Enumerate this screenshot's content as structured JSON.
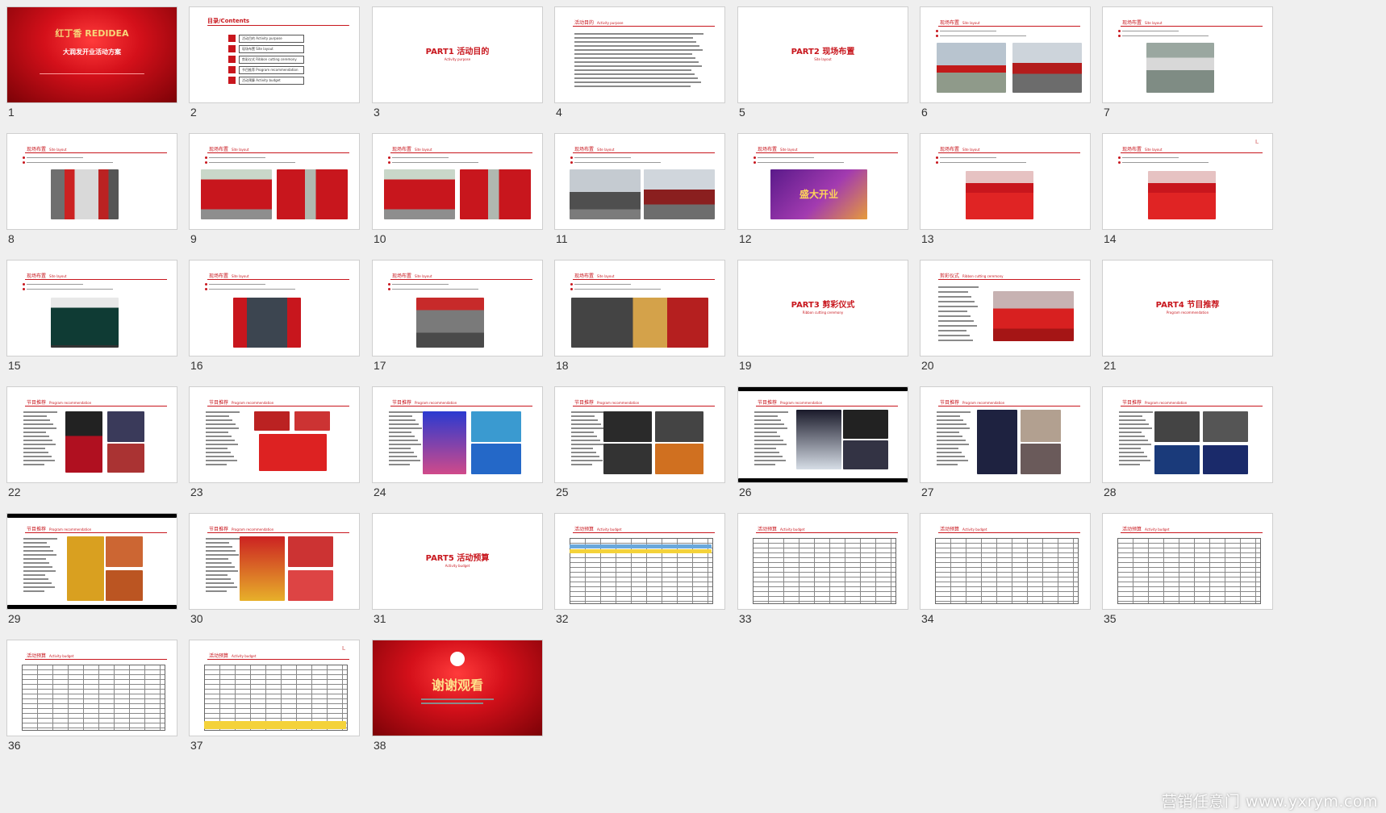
{
  "slides": [
    {
      "num": "1",
      "kind": "cover",
      "brand_cn": "红丁香",
      "brand_en": "REDIDEA",
      "title": "大润发开业活动方案"
    },
    {
      "num": "2",
      "kind": "toc",
      "title": "目录/Contents",
      "items": [
        {
          "cn": "活动目的",
          "en": "Activity purpose"
        },
        {
          "cn": "现场布置",
          "en": "Site layout"
        },
        {
          "cn": "剪彩仪式",
          "en": "Ribbon cutting ceremony"
        },
        {
          "cn": "节目推荐",
          "en": "Program recommendation"
        },
        {
          "cn": "活动预算",
          "en": "Activity budget"
        }
      ]
    },
    {
      "num": "3",
      "kind": "part",
      "title": "PART1  活动目的",
      "sub": "Activity purpose"
    },
    {
      "num": "4",
      "kind": "text",
      "hdr": "活动目的",
      "hdr_en": "Activity purpose"
    },
    {
      "num": "5",
      "kind": "part",
      "title": "PART2  现场布置",
      "sub": "Site layout"
    },
    {
      "num": "6",
      "kind": "photo",
      "hdr": "现场布置",
      "hdr_en": "Site layout"
    },
    {
      "num": "7",
      "kind": "photo",
      "hdr": "现场布置",
      "hdr_en": "Site layout"
    },
    {
      "num": "8",
      "kind": "photo",
      "hdr": "现场布置",
      "hdr_en": "Site layout"
    },
    {
      "num": "9",
      "kind": "photo",
      "hdr": "现场布置",
      "hdr_en": "Site layout"
    },
    {
      "num": "10",
      "kind": "photo",
      "hdr": "现场布置",
      "hdr_en": "Site layout"
    },
    {
      "num": "11",
      "kind": "photo",
      "hdr": "现场布置",
      "hdr_en": "Site layout"
    },
    {
      "num": "12",
      "kind": "photo",
      "hdr": "现场布置",
      "hdr_en": "Site layout",
      "banner": "盛大开业"
    },
    {
      "num": "13",
      "kind": "photo",
      "hdr": "现场布置",
      "hdr_en": "Site layout"
    },
    {
      "num": "14",
      "kind": "photo",
      "hdr": "现场布置",
      "hdr_en": "Site layout"
    },
    {
      "num": "15",
      "kind": "photo",
      "hdr": "现场布置",
      "hdr_en": "Site layout"
    },
    {
      "num": "16",
      "kind": "photo",
      "hdr": "现场布置",
      "hdr_en": "Site layout"
    },
    {
      "num": "17",
      "kind": "photo",
      "hdr": "现场布置",
      "hdr_en": "Site layout"
    },
    {
      "num": "18",
      "kind": "photo",
      "hdr": "现场布置",
      "hdr_en": "Site layout"
    },
    {
      "num": "19",
      "kind": "part",
      "title": "PART3  剪彩仪式",
      "sub": "Ribbon cutting ceremony"
    },
    {
      "num": "20",
      "kind": "photo",
      "hdr": "剪彩仪式",
      "hdr_en": "Ribbon cutting ceremony"
    },
    {
      "num": "21",
      "kind": "part",
      "title": "PART4  节目推荐",
      "sub": "Program recommendation"
    },
    {
      "num": "22",
      "kind": "program",
      "hdr": "节目推荐",
      "hdr_en": "Program recommendation"
    },
    {
      "num": "23",
      "kind": "program",
      "hdr": "节目推荐",
      "hdr_en": "Program recommendation"
    },
    {
      "num": "24",
      "kind": "program",
      "hdr": "节目推荐",
      "hdr_en": "Program recommendation"
    },
    {
      "num": "25",
      "kind": "program",
      "hdr": "节目推荐",
      "hdr_en": "Program recommendation"
    },
    {
      "num": "26",
      "kind": "program",
      "hdr": "节目推荐",
      "hdr_en": "Program recommendation"
    },
    {
      "num": "27",
      "kind": "program",
      "hdr": "节目推荐",
      "hdr_en": "Program recommendation"
    },
    {
      "num": "28",
      "kind": "program",
      "hdr": "节目推荐",
      "hdr_en": "Program recommendation"
    },
    {
      "num": "29",
      "kind": "program",
      "hdr": "节目推荐",
      "hdr_en": "Program recommendation"
    },
    {
      "num": "30",
      "kind": "program",
      "hdr": "节目推荐",
      "hdr_en": "Program recommendation"
    },
    {
      "num": "31",
      "kind": "part",
      "title": "PART5  活动预算",
      "sub": "Activity budget"
    },
    {
      "num": "32",
      "kind": "table",
      "hdr": "活动预算",
      "hdr_en": "Activity budget"
    },
    {
      "num": "33",
      "kind": "table",
      "hdr": "活动预算",
      "hdr_en": "Activity budget"
    },
    {
      "num": "34",
      "kind": "table",
      "hdr": "活动预算",
      "hdr_en": "Activity budget"
    },
    {
      "num": "35",
      "kind": "table",
      "hdr": "活动预算",
      "hdr_en": "Activity budget"
    },
    {
      "num": "36",
      "kind": "table",
      "hdr": "活动预算",
      "hdr_en": "Activity budget"
    },
    {
      "num": "37",
      "kind": "table",
      "hdr": "活动预算",
      "hdr_en": "Activity budget"
    },
    {
      "num": "38",
      "kind": "end",
      "title": "谢谢观看"
    }
  ],
  "watermark": "营销任意门 www.yxrym.com",
  "colors": {
    "accent": "#c8161d",
    "background": "#efefef"
  }
}
